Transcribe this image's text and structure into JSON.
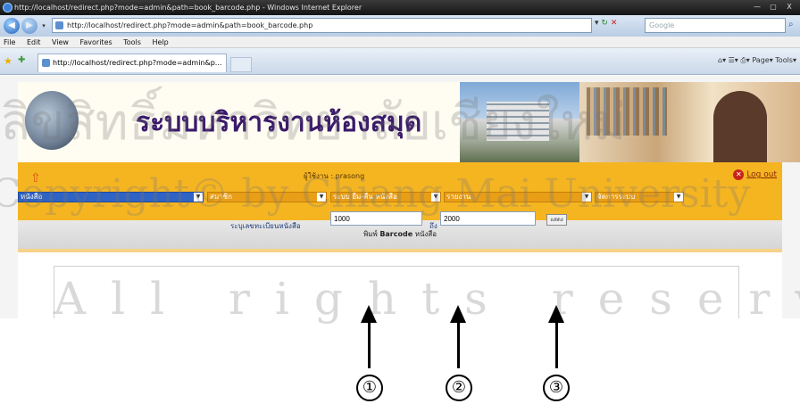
{
  "window": {
    "title": "http://localhost/redirect.php?mode=admin&path=book_barcode.php - Windows Internet Explorer",
    "controls": [
      "—",
      "▢",
      "X"
    ]
  },
  "address": {
    "url": "http://localhost/redirect.php?mode=admin&path=book_barcode.php",
    "search_placeholder": "Google"
  },
  "menubar": [
    "File",
    "Edit",
    "View",
    "Favorites",
    "Tools",
    "Help"
  ],
  "tab": {
    "label": "http://localhost/redirect.php?mode=admin&p..."
  },
  "command_bar": [
    "Page",
    "Tools"
  ],
  "header": {
    "title": "ระบบบริหารงานห้องสมุด"
  },
  "nav": {
    "user_label": "ผู้ใช้งาน : prasong",
    "logout": "Log out",
    "menus": [
      "หนังสือ",
      "สมาชิก",
      "ระบบ ยืม-คืน หนังสือ",
      "รายงาน",
      "จัดการระบบ"
    ]
  },
  "subhead": {
    "bold": "Barcode",
    "prefix": "พิมพ์",
    "suffix": "หนังสือ"
  },
  "form": {
    "label": "ระบุเลขทะเบียนหนังสือ",
    "from_value": "1000",
    "to_label": "ถึง",
    "to_value": "2000",
    "button": "แสดง"
  },
  "watermark": {
    "line1": "ลิขสิทธิ์มหาวิทยาลัยเชียงใหม่",
    "line2": "Copyright© by Chiang Mai University",
    "line3": "All rights reserved"
  },
  "callouts": [
    "①",
    "②",
    "③"
  ]
}
